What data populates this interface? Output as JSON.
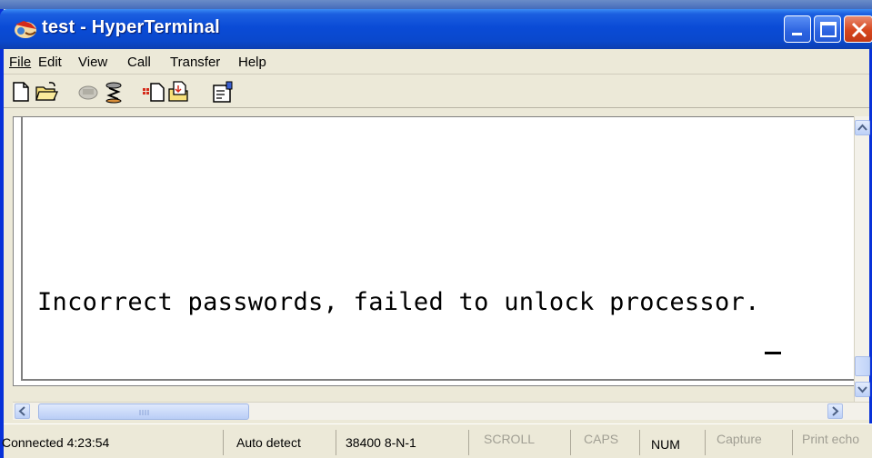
{
  "window": {
    "title": "test - HyperTerminal",
    "accent": "#0a48cc",
    "icon": "hyperterminal-app-icon"
  },
  "menu": [
    {
      "label": "File"
    },
    {
      "label": "Edit"
    },
    {
      "label": "View"
    },
    {
      "label": "Call"
    },
    {
      "label": "Transfer"
    },
    {
      "label": "Help"
    }
  ],
  "toolbar": [
    {
      "icon": "new-document-icon"
    },
    {
      "icon": "open-folder-icon"
    },
    {
      "icon": "call-icon"
    },
    {
      "icon": "disconnect-icon"
    },
    {
      "icon": "send-icon"
    },
    {
      "icon": "receive-icon"
    },
    {
      "icon": "properties-icon"
    }
  ],
  "terminal": {
    "text": "Incorrect passwords, failed to unlock processor.",
    "cursor": "_"
  },
  "status": {
    "connected": "Connected 4:23:54",
    "detect": "Auto detect",
    "settings": "38400 8-N-1",
    "scroll": "SCROLL",
    "caps": "CAPS",
    "num": "NUM",
    "capture": "Capture",
    "print_echo": "Print echo"
  }
}
